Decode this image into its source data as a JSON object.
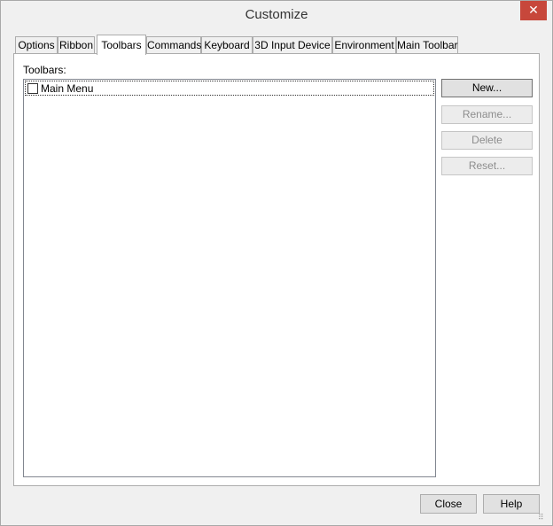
{
  "window": {
    "title": "Customize",
    "close_glyph": "✕"
  },
  "tabs": [
    {
      "label": "Options"
    },
    {
      "label": "Ribbon"
    },
    {
      "label": "Toolbars"
    },
    {
      "label": "Commands"
    },
    {
      "label": "Keyboard"
    },
    {
      "label": "3D Input Device"
    },
    {
      "label": "Environment"
    },
    {
      "label": "Main Toolbar"
    }
  ],
  "active_tab": "Toolbars",
  "toolbars_section": {
    "label": "Toolbars:",
    "items": [
      {
        "label": "Main Menu",
        "checked": false
      }
    ]
  },
  "side_buttons": {
    "new": "New...",
    "rename": "Rename...",
    "delete": "Delete",
    "reset": "Reset..."
  },
  "footer": {
    "close": "Close",
    "help": "Help"
  },
  "icons": {
    "close": "close-icon",
    "resize": "resize-grip-icon"
  }
}
